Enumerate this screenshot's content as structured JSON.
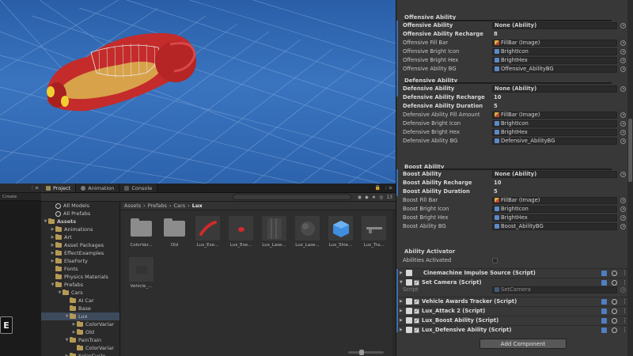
{
  "project_panel": {
    "tabs": [
      {
        "label": "Project",
        "icon": "folder-icon"
      },
      {
        "label": "Animation",
        "icon": "animation-icon"
      },
      {
        "label": "Console",
        "icon": "console-icon"
      }
    ],
    "create_label": "Create",
    "asset_count": "13",
    "breadcrumb": [
      "Assets",
      "Prefabs",
      "Cars",
      "Lux"
    ],
    "tree": [
      {
        "label": "All Models",
        "indent": 1,
        "icon": "search",
        "arrow": ""
      },
      {
        "label": "All Prefabs",
        "indent": 1,
        "icon": "search",
        "arrow": ""
      },
      {
        "label": "Assets",
        "indent": 0,
        "icon": "folder",
        "arrow": "▼",
        "bold": true
      },
      {
        "label": "Animations",
        "indent": 1,
        "icon": "folder",
        "arrow": "▶"
      },
      {
        "label": "Art",
        "indent": 1,
        "icon": "folder",
        "arrow": "▶"
      },
      {
        "label": "Asset Packages",
        "indent": 1,
        "icon": "folder",
        "arrow": "▶"
      },
      {
        "label": "EffectExamples",
        "indent": 1,
        "icon": "folder",
        "arrow": "▶"
      },
      {
        "label": "ElseForty",
        "indent": 1,
        "icon": "folder",
        "arrow": "▶"
      },
      {
        "label": "Fonts",
        "indent": 1,
        "icon": "folder",
        "arrow": ""
      },
      {
        "label": "Physics Materials",
        "indent": 1,
        "icon": "folder",
        "arrow": ""
      },
      {
        "label": "Prefabs",
        "indent": 1,
        "icon": "folder",
        "arrow": "▼"
      },
      {
        "label": "Cars",
        "indent": 2,
        "icon": "folder",
        "arrow": "▼"
      },
      {
        "label": "AI Car",
        "indent": 3,
        "icon": "folder",
        "arrow": ""
      },
      {
        "label": "Base",
        "indent": 3,
        "icon": "folder",
        "arrow": ""
      },
      {
        "label": "Lux",
        "indent": 3,
        "icon": "folder",
        "arrow": "▼",
        "selected": true
      },
      {
        "label": "ColorVariar",
        "indent": 4,
        "icon": "folder",
        "arrow": "▶"
      },
      {
        "label": "Old",
        "indent": 4,
        "icon": "folder",
        "arrow": "▶"
      },
      {
        "label": "PainTrain",
        "indent": 3,
        "icon": "folder",
        "arrow": "▼"
      },
      {
        "label": "ColorVariar",
        "indent": 4,
        "icon": "folder",
        "arrow": ""
      },
      {
        "label": "SolarCycle",
        "indent": 3,
        "icon": "folder",
        "arrow": "▶"
      }
    ],
    "assets": [
      {
        "label": "ColorVar...",
        "kind": "folder"
      },
      {
        "label": "Old",
        "kind": "folder"
      },
      {
        "label": "Lux_Exe...",
        "kind": "red-curve"
      },
      {
        "label": "Lux_Exe...",
        "kind": "red-dot"
      },
      {
        "label": "Lux_Lase...",
        "kind": "stripes"
      },
      {
        "label": "Lux_Lase...",
        "kind": "sphere"
      },
      {
        "label": "Lux_Shie...",
        "kind": "blue-cube"
      },
      {
        "label": "Lux_Tra...",
        "kind": "gun"
      },
      {
        "label": "Vehicle_...",
        "kind": "dark"
      }
    ]
  },
  "inspector": {
    "offensive": {
      "title": "Offensive Ability",
      "rows": [
        {
          "label": "Offensive Ability",
          "value": "None (Ability)",
          "bold": true,
          "ref": "none"
        },
        {
          "label": "Offensive Ability Recharge",
          "value": "8",
          "bold": true,
          "ref": "plain"
        },
        {
          "label": "Offensive Fill Bar",
          "value": "FillBar (Image)",
          "ref": "img"
        },
        {
          "label": "Offensive Bright Icon",
          "value": "BrightIcon",
          "ref": "obj"
        },
        {
          "label": "Offensive Bright Hex",
          "value": "BrightHex",
          "ref": "obj"
        },
        {
          "label": "Offensive Ability BG",
          "value": "Offensive_AbilityBG",
          "ref": "obj"
        }
      ]
    },
    "defensive": {
      "title": "Defensive Ability",
      "rows": [
        {
          "label": "Defensive Ability",
          "value": "None (Ability)",
          "bold": true,
          "ref": "none"
        },
        {
          "label": "Defensive Ability Recharge",
          "value": "10",
          "bold": true,
          "ref": "plain"
        },
        {
          "label": "Defensive Ability Duration",
          "value": "5",
          "bold": true,
          "ref": "plain"
        },
        {
          "label": "Defensive Ability Fill Amount",
          "value": "FillBar (Image)",
          "ref": "img"
        },
        {
          "label": "Defensive Bright Icon",
          "value": "BrightIcon",
          "ref": "obj"
        },
        {
          "label": "Defensive Bright Hex",
          "value": "BrightHex",
          "ref": "obj"
        },
        {
          "label": "Defensive Ability BG",
          "value": "Defensive_AbilityBG",
          "ref": "obj"
        }
      ]
    },
    "boost": {
      "title": "Boost Ability",
      "rows": [
        {
          "label": "Boost Ability",
          "value": "None (Ability)",
          "bold": true,
          "ref": "none"
        },
        {
          "label": "Boost Ability Recharge",
          "value": "10",
          "bold": true,
          "ref": "plain"
        },
        {
          "label": "Boost Ability Duration",
          "value": "5",
          "bold": true,
          "ref": "plain"
        },
        {
          "label": "Boost Fill Bar",
          "value": "FillBar (Image)",
          "ref": "img"
        },
        {
          "label": "Boost Bright Icon",
          "value": "BrightIcon",
          "ref": "obj"
        },
        {
          "label": "Boost Bright Hex",
          "value": "BrightHex",
          "ref": "obj"
        },
        {
          "label": "Boost Ability BG",
          "value": "Boost_AbilityBG",
          "ref": "obj"
        }
      ]
    },
    "activator": {
      "title": "Ability Activator",
      "abilities_label": "Abilities Activated"
    },
    "components": [
      {
        "name": "Cinemachine Impulse Source (Script)",
        "checkbox": false,
        "folded": true
      },
      {
        "name": "Set Camera (Script)",
        "checkbox": true,
        "folded": false
      },
      {
        "name": "Vehicle Awards Tracker (Script)",
        "checkbox": true,
        "folded": true
      },
      {
        "name": "Lux_Attack 2 (Script)",
        "checkbox": true,
        "folded": true
      },
      {
        "name": "Lux_Boost Ability (Script)",
        "checkbox": true,
        "folded": true
      },
      {
        "name": "Lux_Defensive Ability (Script)",
        "checkbox": true,
        "folded": true
      }
    ],
    "script_label": "Script",
    "script_value": "SetCamera",
    "add_component_label": "Add Component"
  }
}
